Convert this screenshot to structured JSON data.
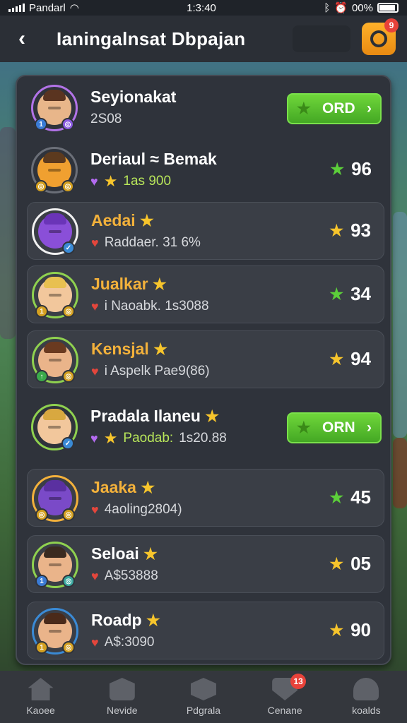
{
  "status_bar": {
    "carrier": "Pandarl",
    "time": "1:3:40",
    "battery": "00%"
  },
  "header": {
    "title": "Ianingalnsat Dbpajan",
    "notification_count": "9"
  },
  "players": [
    {
      "name": "Seyionakat",
      "sub": "2S08",
      "score": "",
      "button": "ORD",
      "heart": "",
      "star_label": ""
    },
    {
      "name": "Deriaul ≈ Bemak",
      "sub": "1as 900",
      "score": "96"
    },
    {
      "name": "Aedai",
      "sub": "Raddaer. 31 6%",
      "score": "93"
    },
    {
      "name": "Jualkar",
      "sub": "i Naoabk. 1s3088",
      "score": "34"
    },
    {
      "name": "Kensjal",
      "sub": "i Aspelk Pae9(86)",
      "score": "94"
    },
    {
      "name": "Pradala Ilaneu",
      "sub_label": "Paodab:",
      "sub": "1s20.88",
      "button": "ORN"
    },
    {
      "name": "Jaaka",
      "sub": "4aoling2804)",
      "score": "45"
    },
    {
      "name": "Seloai",
      "sub": "A$53888",
      "score": "05"
    },
    {
      "name": "Roadp",
      "sub": "A$:3090",
      "score": "90"
    }
  ],
  "tabs": [
    {
      "label": "Kaoee",
      "icon": "house-icon"
    },
    {
      "label": "Nevide",
      "icon": "shop-icon"
    },
    {
      "label": "Pdgrala",
      "icon": "box-icon"
    },
    {
      "label": "Cenane",
      "icon": "shield-icon",
      "badge": "13"
    },
    {
      "label": "koalds",
      "icon": "profile-icon"
    }
  ]
}
